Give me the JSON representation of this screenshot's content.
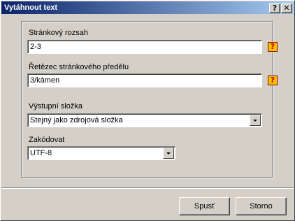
{
  "window": {
    "title": "Vytáhnout text",
    "help_button": "?",
    "close_button": "✕"
  },
  "fields": {
    "page_range": {
      "label": "Stránkový rozsah",
      "value": "2-3",
      "help": "?"
    },
    "page_break": {
      "label": "Řetězec stránkového předělu",
      "value": "3/kámen",
      "help": "?"
    },
    "output_folder": {
      "label": "Výstupní složka",
      "value": "Stejný jako zdrojová složka"
    },
    "encoding": {
      "label": "Zakódovat",
      "value": "UTF-8"
    }
  },
  "buttons": {
    "run": "Spusť",
    "cancel": "Storno"
  }
}
